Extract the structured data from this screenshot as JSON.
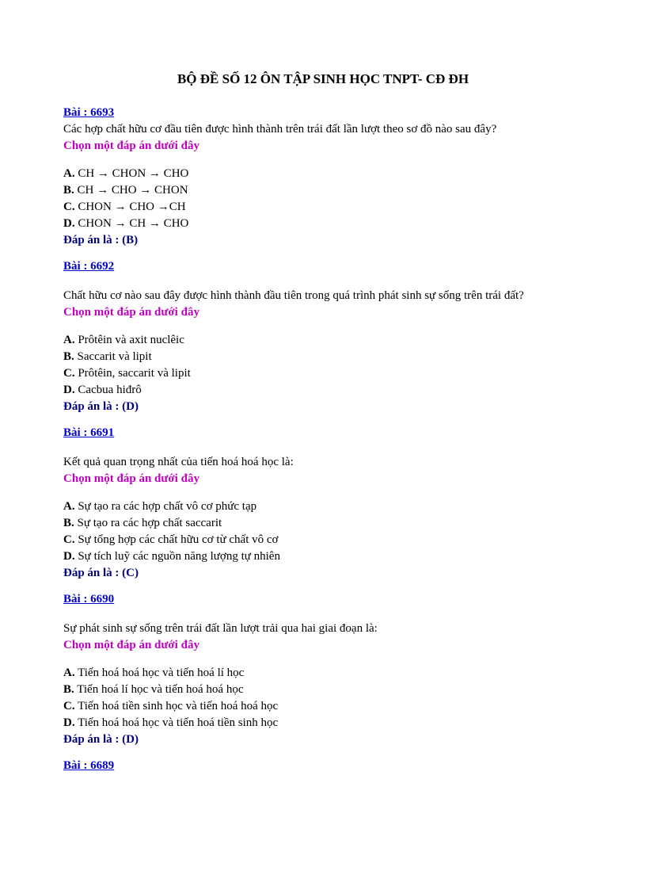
{
  "title": "BỘ ĐỀ SỐ 12  ÔN TẬP SINH HỌC TNPT- CĐ ĐH",
  "instruction": "Chọn một đáp án dưới đây",
  "answerPrefix": "Đáp án là : ",
  "questions": [
    {
      "link": "Bài : 6693 ",
      "text": "Các hợp chất hữu cơ đầu tiên được hình thành trên trái đất lần lượt theo sơ đồ nào sau đây?",
      "options": [
        {
          "letter": "A.",
          "text": " CH → CHON → CHO"
        },
        {
          "letter": "B.",
          "text": " CH → CHO → CHON"
        },
        {
          "letter": "C.",
          "text": " CHON → CHO →CH"
        },
        {
          "letter": "D.",
          "text": " CHON → CH → CHO"
        }
      ],
      "answer": "(B)"
    },
    {
      "link": "Bài : 6692 ",
      "text": "Chất hữu cơ nào sau đây được hình thành đầu tiên trong quá trình phát sinh sự sống trên trái đất?",
      "options": [
        {
          "letter": "A.",
          "text": " Prôtêin và axit nuclêic"
        },
        {
          "letter": "B.",
          "text": " Saccarit và lipit"
        },
        {
          "letter": "C.",
          "text": " Prôtêin, saccarit và lipit"
        },
        {
          "letter": "D.",
          "text": " Cacbua hiđrô"
        }
      ],
      "answer": "(D)"
    },
    {
      "link": "Bài : 6691 ",
      "text": "Kết quả quan trọng nhất của tiến hoá hoá học là:",
      "options": [
        {
          "letter": "A.",
          "text": " Sự tạo ra các hợp chất vô cơ phức tạp"
        },
        {
          "letter": "B.",
          "text": " Sự tạo ra các hợp chất saccarit"
        },
        {
          "letter": "C.",
          "text": " Sự tổng hợp các chất hữu cơ từ chất vô cơ"
        },
        {
          "letter": "D.",
          "text": " Sự tích luỹ các nguồn năng lượng tự nhiên"
        }
      ],
      "answer": "(C)"
    },
    {
      "link": "Bài : 6690 ",
      "text": "Sự phát sinh sự sống trên trái đất lần lượt trải qua hai giai đoạn là:",
      "options": [
        {
          "letter": "A.",
          "text": " Tiến hoá hoá học và tiến hoá lí học"
        },
        {
          "letter": "B.",
          "text": " Tiến hoá lí học và tiến hoá hoá học"
        },
        {
          "letter": "C.",
          "text": " Tiến hoá tiền sinh học và tiến hoá hoá học"
        },
        {
          "letter": "D.",
          "text": " Tiến hoá hoá học và tiến hoá tiền sinh học"
        }
      ],
      "answer": "(D)"
    },
    {
      "link": "Bài : 6689 ",
      "text": "",
      "options": [],
      "answer": ""
    }
  ]
}
